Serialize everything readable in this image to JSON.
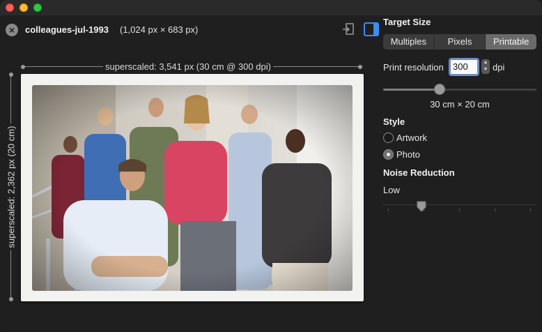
{
  "file": {
    "name": "colleagues-jul-1993",
    "dimensions": "(1,024 px × 683 px)"
  },
  "preview": {
    "horizontal_label": "superscaled: 3,541 px (30 cm @ 300 dpi)",
    "vertical_label": "superscaled: 2,362 px (20 cm)"
  },
  "panel": {
    "target_size_title": "Target Size",
    "tabs": [
      {
        "label": "Multiples",
        "active": false
      },
      {
        "label": "Pixels",
        "active": false
      },
      {
        "label": "Printable",
        "active": true
      }
    ],
    "resolution_label": "Print resolution",
    "resolution_value": "300",
    "resolution_unit": "dpi",
    "resolution_slider": 0.37,
    "print_size": "30 cm × 20 cm",
    "style_title": "Style",
    "style_options": [
      {
        "label": "Artwork",
        "checked": false
      },
      {
        "label": "Photo",
        "checked": true
      }
    ],
    "noise_title": "Noise Reduction",
    "noise_value": "Low",
    "noise_slider": 0.25
  },
  "colors": {
    "window_bg": "#1f1f1f",
    "focus_ring": "#6d8fc2",
    "segment_active": "#6a6a6a"
  },
  "icons": [
    "close-icon",
    "export-icon",
    "sidebar-toggle-icon",
    "stepper-icon"
  ]
}
